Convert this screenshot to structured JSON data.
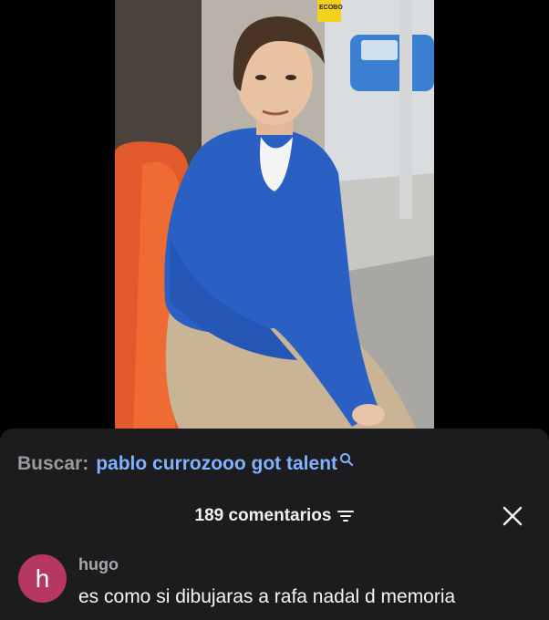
{
  "video": {
    "signage_text": "ECOBO"
  },
  "search": {
    "label": "Buscar:",
    "query": "pablo currozooo got talent",
    "icon": "search-icon"
  },
  "comments": {
    "count_label": "189 comentarios",
    "sort_icon": "sort-icon",
    "close_icon": "close-icon"
  },
  "comment": {
    "avatar_letter": "h",
    "avatar_color": "#b63664",
    "username": "hugo",
    "text": "es como si dibujaras a rafa nadal d memoria"
  },
  "colors": {
    "sheet_background": "#1c1c1e",
    "search_query": "#7fb3ff",
    "search_label": "#9a9a9e"
  }
}
